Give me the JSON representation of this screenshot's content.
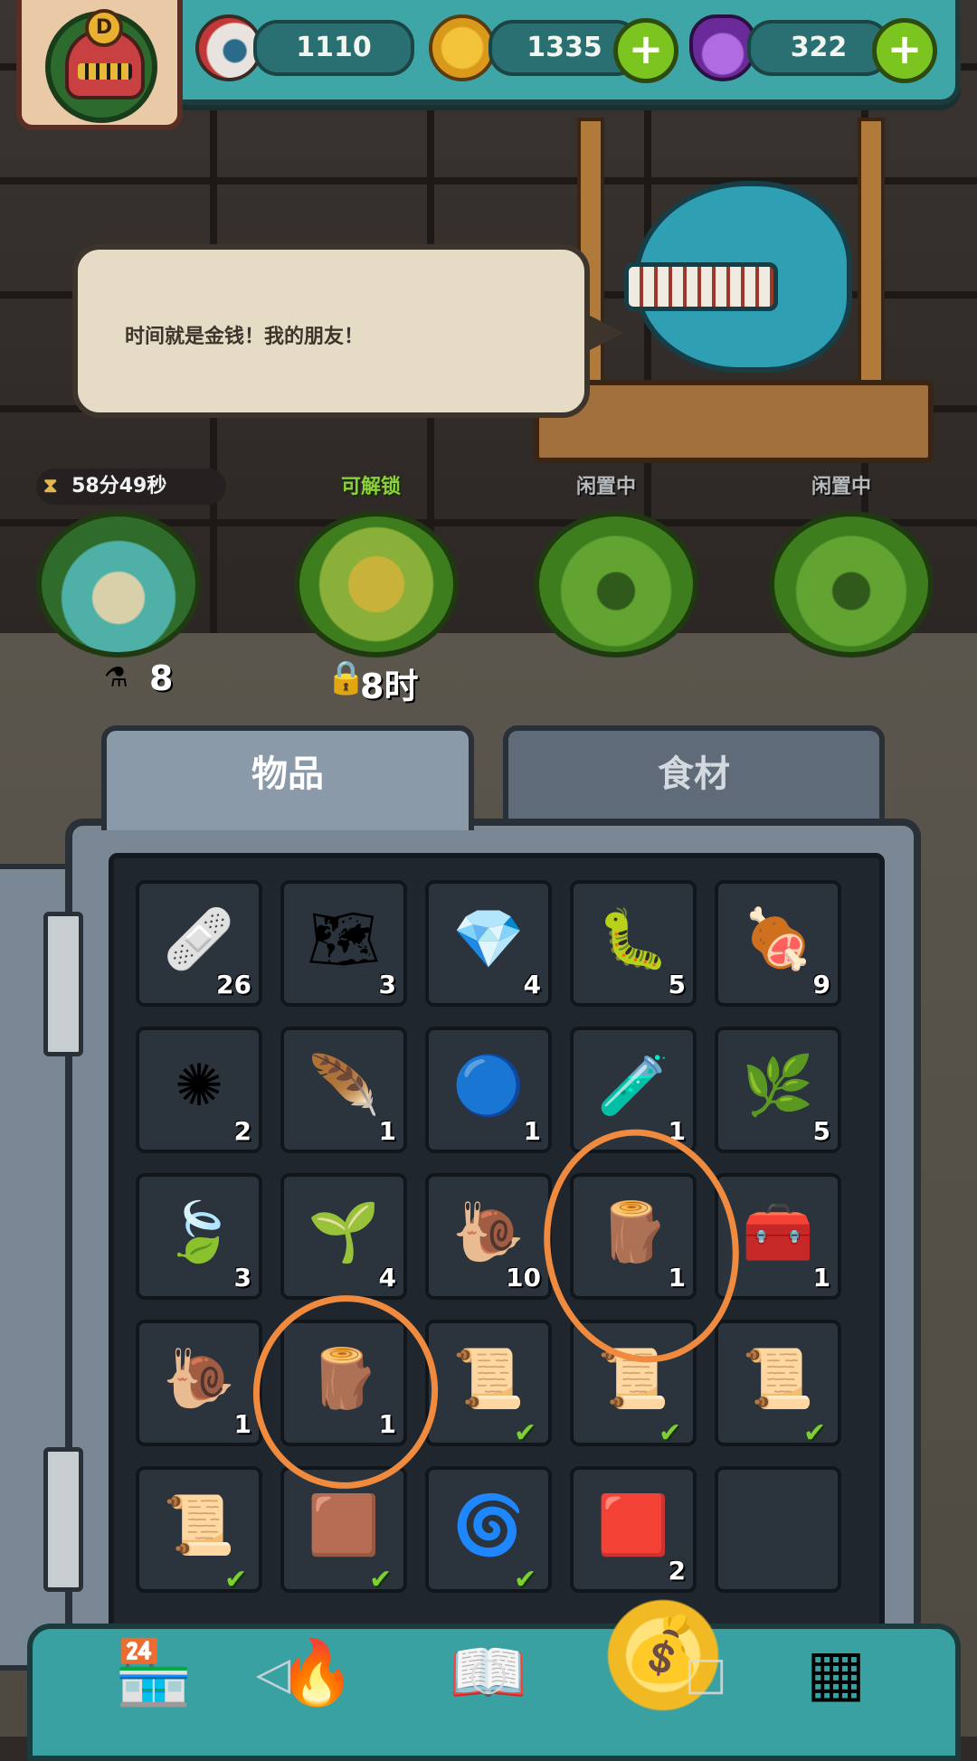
{
  "resources": {
    "eyes": "1110",
    "coins": "1335",
    "potions": "322"
  },
  "avatar": {
    "badge": "D"
  },
  "npc": {
    "speech": "时间就是金钱！我的朋友！"
  },
  "slots": [
    {
      "timer": "58分49秒",
      "count": "8"
    },
    {
      "status": "可解锁",
      "lock_time": "8时"
    },
    {
      "status": "闲置中"
    },
    {
      "status": "闲置中"
    }
  ],
  "tabs": {
    "items": "物品",
    "ingredients": "食材"
  },
  "inventory": [
    {
      "icon": "bandage-icon",
      "glyph": "🩹",
      "count": "26"
    },
    {
      "icon": "map-icon",
      "glyph": "🗺",
      "count": "3"
    },
    {
      "icon": "crystal-icon",
      "glyph": "💎",
      "count": "4"
    },
    {
      "icon": "worm-icon",
      "glyph": "🐛",
      "count": "5"
    },
    {
      "icon": "club-icon",
      "glyph": "🍖",
      "count": "9"
    },
    {
      "icon": "urchin-icon",
      "glyph": "✺",
      "count": "2"
    },
    {
      "icon": "feather-icon",
      "glyph": "🪶",
      "count": "1"
    },
    {
      "icon": "orb-icon",
      "glyph": "🔵",
      "count": "1"
    },
    {
      "icon": "bottle-skull-icon",
      "glyph": "🧪",
      "count": "1"
    },
    {
      "icon": "purple-plant-icon",
      "glyph": "🌿",
      "count": "5"
    },
    {
      "icon": "leaf-icon",
      "glyph": "🍃",
      "count": "3"
    },
    {
      "icon": "seeds-icon",
      "glyph": "🌱",
      "count": "4"
    },
    {
      "icon": "snail-icon",
      "glyph": "🐌",
      "count": "10"
    },
    {
      "icon": "stump-creature-icon",
      "glyph": "🪵",
      "count": "1"
    },
    {
      "icon": "chest-creature-icon",
      "glyph": "🧰",
      "count": "1"
    },
    {
      "icon": "snail-icon",
      "glyph": "🐌",
      "count": "1"
    },
    {
      "icon": "stump-creature-icon",
      "glyph": "🪵",
      "count": "1"
    },
    {
      "icon": "scroll-icon",
      "glyph": "📜",
      "check": true
    },
    {
      "icon": "scroll-icon",
      "glyph": "📜",
      "check": true
    },
    {
      "icon": "scroll-icon",
      "glyph": "📜",
      "check": true
    },
    {
      "icon": "scroll-icon",
      "glyph": "📜",
      "check": true
    },
    {
      "icon": "rune-tile-icon",
      "glyph": "🟫",
      "check": true
    },
    {
      "icon": "vine-icon",
      "glyph": "🌀",
      "check": true
    },
    {
      "icon": "parchment-map-icon",
      "glyph": "🟥",
      "count": "2"
    },
    {
      "icon": "empty-slot",
      "glyph": ""
    }
  ],
  "colors": {
    "topbar": "#3fa6a8",
    "plus": "#7cc521",
    "annotation": "#ef8a3e",
    "unlockable": "#8bd13a"
  }
}
